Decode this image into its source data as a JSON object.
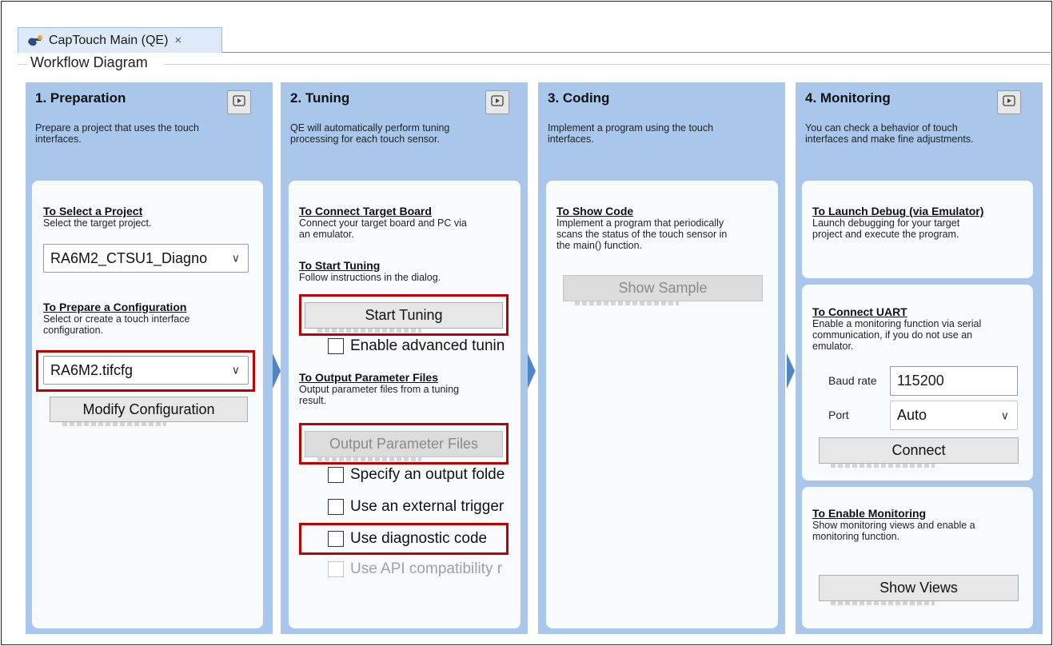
{
  "tab": {
    "title": "CapTouch Main (QE)",
    "close": "×"
  },
  "view_title": "Workflow Diagram",
  "panels": [
    {
      "title": "1. Preparation",
      "desc": [
        "Prepare a project that uses the touch",
        "interfaces."
      ],
      "sections": [
        {
          "title": "To Select a Project",
          "desc": [
            "Select the target project."
          ]
        },
        {
          "title": "To Prepare a Configuration",
          "desc": [
            "Select or create a touch interface",
            "configuration."
          ]
        }
      ],
      "project_select": "RA6M2_CTSU1_Diagno",
      "config_select": "RA6M2.tifcfg",
      "modify_button": "Modify Configuration"
    },
    {
      "title": "2. Tuning",
      "desc": [
        "QE will automatically perform tuning",
        "processing for each touch sensor."
      ],
      "sections": [
        {
          "title": "To Connect Target Board",
          "desc": [
            "Connect your target board and PC via",
            "an emulator."
          ]
        },
        {
          "title": "To Start Tuning",
          "desc": [
            "Follow instructions in the dialog."
          ]
        },
        {
          "title": "To Output Parameter Files",
          "desc": [
            "Output parameter files from a tuning",
            "result."
          ]
        }
      ],
      "start_button": "Start Tuning",
      "advanced_check": "Enable advanced tunin",
      "output_button": "Output Parameter Files",
      "checks": [
        "Specify an output folde",
        "Use an external trigger",
        "Use diagnostic code",
        "Use API compatibility r"
      ]
    },
    {
      "title": "3. Coding",
      "desc": [
        "Implement a program using the touch",
        "interfaces."
      ],
      "sections": [
        {
          "title": "To Show Code",
          "desc": [
            "Implement a program that periodically",
            "scans the status of the touch sensor in",
            "the main() function."
          ]
        }
      ],
      "sample_button": "Show Sample"
    },
    {
      "title": "4. Monitoring",
      "desc": [
        "You can check a behavior of touch",
        "interfaces and make fine adjustments."
      ],
      "sections": [
        {
          "title": "To Launch Debug (via Emulator)",
          "desc": [
            "Launch debugging for your target",
            "project and execute the program."
          ]
        },
        {
          "title": "To Connect UART",
          "desc": [
            "Enable a monitoring function via serial",
            "communication, if you do not use an",
            "emulator."
          ]
        },
        {
          "title": "To Enable Monitoring",
          "desc": [
            "Show monitoring views and enable a",
            "monitoring function."
          ]
        }
      ],
      "baud_label": "Baud rate",
      "baud_value": "115200",
      "port_label": "Port",
      "port_value": "Auto",
      "connect_button": "Connect",
      "views_button": "Show Views"
    }
  ],
  "colors": {
    "panel": "#a9c7ea",
    "highlight": "#c00000",
    "arrow": "#4f86c6",
    "tab_underline": "#5b9bd5"
  }
}
